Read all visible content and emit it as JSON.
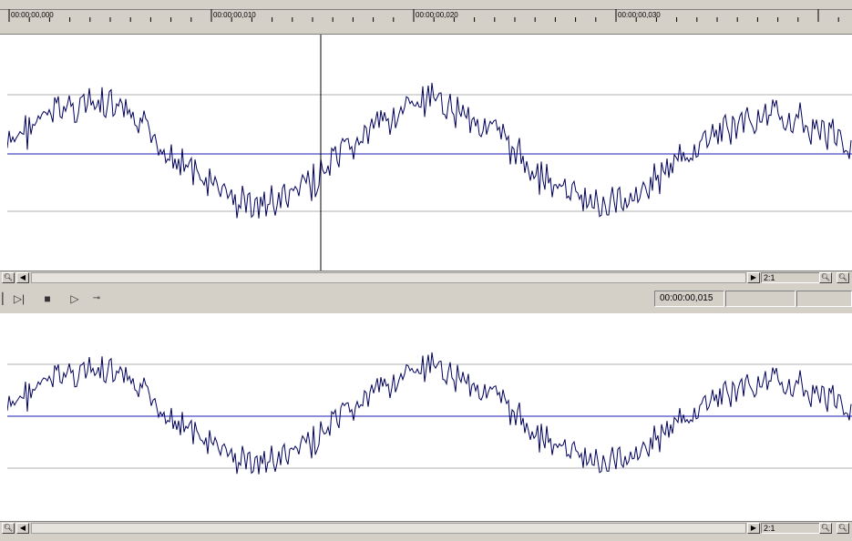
{
  "timeline": {
    "ticks": [
      "00:00:00,000",
      "00:00:00,010",
      "00:00:00,020",
      "00:00:00,030"
    ]
  },
  "top_pane": {
    "zoom": "2:1",
    "cursor_time": "00:00:00,015"
  },
  "transport": {
    "current_time": "00:00:00,015",
    "field_2": "",
    "field_3": ""
  },
  "bottom_pane": {
    "zoom": "2:1"
  },
  "icons": {
    "zoom": "magnifier-icon",
    "left": "arrow-left-icon",
    "right": "arrow-right-icon",
    "play": "play-icon",
    "stop": "stop-icon",
    "go_end": "go-to-end-icon",
    "loop": "loop-icon"
  },
  "colors": {
    "waveform": "#000060",
    "center_line": "#1a1ab0",
    "grid": "#b0b0b0",
    "background": "#d4d0c8",
    "cursor": "#000000"
  }
}
